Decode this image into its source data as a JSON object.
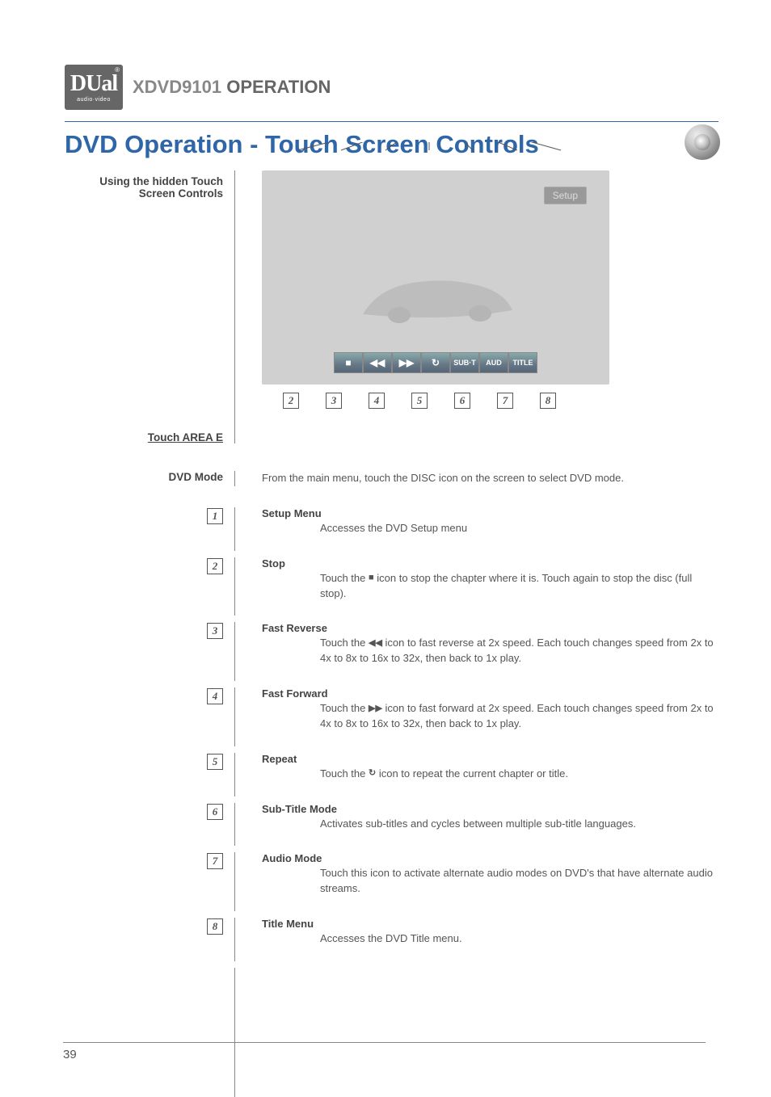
{
  "header": {
    "brand": "DUal",
    "brand_sub": "audio·video",
    "model": "XDVD9101",
    "operation": "OPERATION"
  },
  "title": "DVD Operation - Touch Screen Controls",
  "left_labels": {
    "using": "Using the hidden Touch Screen Controls",
    "area": "Touch AREA E",
    "dvd_mode": "DVD Mode"
  },
  "screenshot": {
    "setup": "Setup",
    "toolbar": [
      "■",
      "◀◀",
      "▶▶",
      "↻",
      "SUB·T",
      "AUD",
      "TITLE"
    ]
  },
  "dvd_mode_text": "From the main menu, touch the DISC icon on the screen to select DVD mode.",
  "features": [
    {
      "num": "1",
      "title": "Setup Menu",
      "desc": "Accesses the DVD Setup menu"
    },
    {
      "num": "2",
      "title": "Stop",
      "desc_pre": "Touch the ",
      "icon": "■",
      "desc_post": " icon to stop the chapter where it is. Touch again to stop the disc (full stop)."
    },
    {
      "num": "3",
      "title": "Fast Reverse",
      "desc_pre": "Touch the ",
      "icon": "◀◀",
      "desc_post": " icon to fast reverse at 2x speed. Each touch changes speed from 2x to 4x to 8x to 16x to 32x, then back to 1x play."
    },
    {
      "num": "4",
      "title": "Fast Forward",
      "desc_pre": "Touch the ",
      "icon": "▶▶",
      "desc_post": " icon to fast forward at 2x speed. Each touch changes speed from 2x to 4x to 8x to 16x to 32x, then back to 1x play."
    },
    {
      "num": "5",
      "title": "Repeat",
      "desc_pre": "Touch the ",
      "icon": "↻",
      "desc_post": " icon to repeat the current chapter or title."
    },
    {
      "num": "6",
      "title": "Sub-Title Mode",
      "desc": "Activates sub-titles and cycles between multiple sub-title languages."
    },
    {
      "num": "7",
      "title": "Audio Mode",
      "desc": "Touch this icon to activate alternate audio modes on DVD's that have alternate audio streams."
    },
    {
      "num": "8",
      "title": "Title Menu",
      "desc": "Accesses the DVD Title menu."
    }
  ],
  "page_number": "39"
}
